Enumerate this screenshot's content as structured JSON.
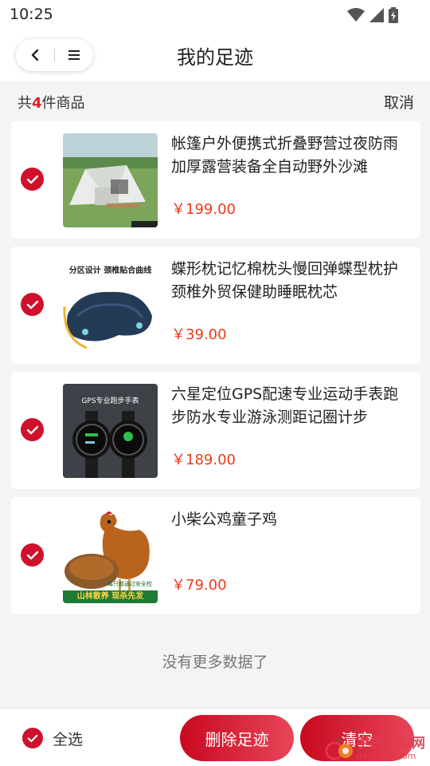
{
  "status_bar": {
    "time": "10:25"
  },
  "header": {
    "title": "我的足迹"
  },
  "summary": {
    "prefix": "共",
    "count": "4",
    "suffix": "件商品",
    "cancel_label": "取消"
  },
  "items": [
    {
      "name": "帐篷户外便携式折叠野营过夜防雨加厚露营装备全自动野外沙滩",
      "price": "￥199.00",
      "selected": true,
      "image": "tent-product-image"
    },
    {
      "name": "蝶形枕记忆棉枕头慢回弹蝶型枕护颈椎外贸保健助睡眠枕芯",
      "price": "￥39.00",
      "selected": true,
      "image": "pillow-product-image",
      "image_text": [
        "分区设计 颈椎贴合曲线"
      ]
    },
    {
      "name": "六星定位GPS配速专业运动手表跑步防水专业游泳测距记圈计步",
      "price": "￥189.00",
      "selected": true,
      "image": "watch-product-image",
      "image_text": [
        "GPS专业跑步手表"
      ]
    },
    {
      "name": "小柴公鸡童子鸡",
      "price": "￥79.00",
      "selected": true,
      "image": "chicken-product-image",
      "image_text": [
        "山林散养 现杀先发",
        "每只都通过安全检"
      ]
    }
  ],
  "no_more": "没有更多数据了",
  "footer": {
    "select_all_label": "全选",
    "delete_label": "删除足迹",
    "clear_label": "清空"
  },
  "watermark": {
    "line1": "手机100网",
    "line2": "danji100.com"
  },
  "colors": {
    "accent": "#d0112b",
    "price": "#ee3a1a"
  }
}
